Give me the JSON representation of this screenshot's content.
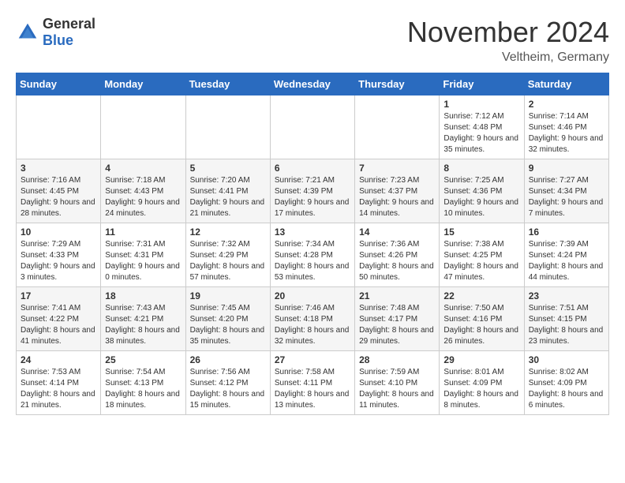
{
  "header": {
    "logo_general": "General",
    "logo_blue": "Blue",
    "month_title": "November 2024",
    "location": "Veltheim, Germany"
  },
  "days_of_week": [
    "Sunday",
    "Monday",
    "Tuesday",
    "Wednesday",
    "Thursday",
    "Friday",
    "Saturday"
  ],
  "weeks": [
    [
      {
        "day": "",
        "info": ""
      },
      {
        "day": "",
        "info": ""
      },
      {
        "day": "",
        "info": ""
      },
      {
        "day": "",
        "info": ""
      },
      {
        "day": "",
        "info": ""
      },
      {
        "day": "1",
        "info": "Sunrise: 7:12 AM\nSunset: 4:48 PM\nDaylight: 9 hours and 35 minutes."
      },
      {
        "day": "2",
        "info": "Sunrise: 7:14 AM\nSunset: 4:46 PM\nDaylight: 9 hours and 32 minutes."
      }
    ],
    [
      {
        "day": "3",
        "info": "Sunrise: 7:16 AM\nSunset: 4:45 PM\nDaylight: 9 hours and 28 minutes."
      },
      {
        "day": "4",
        "info": "Sunrise: 7:18 AM\nSunset: 4:43 PM\nDaylight: 9 hours and 24 minutes."
      },
      {
        "day": "5",
        "info": "Sunrise: 7:20 AM\nSunset: 4:41 PM\nDaylight: 9 hours and 21 minutes."
      },
      {
        "day": "6",
        "info": "Sunrise: 7:21 AM\nSunset: 4:39 PM\nDaylight: 9 hours and 17 minutes."
      },
      {
        "day": "7",
        "info": "Sunrise: 7:23 AM\nSunset: 4:37 PM\nDaylight: 9 hours and 14 minutes."
      },
      {
        "day": "8",
        "info": "Sunrise: 7:25 AM\nSunset: 4:36 PM\nDaylight: 9 hours and 10 minutes."
      },
      {
        "day": "9",
        "info": "Sunrise: 7:27 AM\nSunset: 4:34 PM\nDaylight: 9 hours and 7 minutes."
      }
    ],
    [
      {
        "day": "10",
        "info": "Sunrise: 7:29 AM\nSunset: 4:33 PM\nDaylight: 9 hours and 3 minutes."
      },
      {
        "day": "11",
        "info": "Sunrise: 7:31 AM\nSunset: 4:31 PM\nDaylight: 9 hours and 0 minutes."
      },
      {
        "day": "12",
        "info": "Sunrise: 7:32 AM\nSunset: 4:29 PM\nDaylight: 8 hours and 57 minutes."
      },
      {
        "day": "13",
        "info": "Sunrise: 7:34 AM\nSunset: 4:28 PM\nDaylight: 8 hours and 53 minutes."
      },
      {
        "day": "14",
        "info": "Sunrise: 7:36 AM\nSunset: 4:26 PM\nDaylight: 8 hours and 50 minutes."
      },
      {
        "day": "15",
        "info": "Sunrise: 7:38 AM\nSunset: 4:25 PM\nDaylight: 8 hours and 47 minutes."
      },
      {
        "day": "16",
        "info": "Sunrise: 7:39 AM\nSunset: 4:24 PM\nDaylight: 8 hours and 44 minutes."
      }
    ],
    [
      {
        "day": "17",
        "info": "Sunrise: 7:41 AM\nSunset: 4:22 PM\nDaylight: 8 hours and 41 minutes."
      },
      {
        "day": "18",
        "info": "Sunrise: 7:43 AM\nSunset: 4:21 PM\nDaylight: 8 hours and 38 minutes."
      },
      {
        "day": "19",
        "info": "Sunrise: 7:45 AM\nSunset: 4:20 PM\nDaylight: 8 hours and 35 minutes."
      },
      {
        "day": "20",
        "info": "Sunrise: 7:46 AM\nSunset: 4:18 PM\nDaylight: 8 hours and 32 minutes."
      },
      {
        "day": "21",
        "info": "Sunrise: 7:48 AM\nSunset: 4:17 PM\nDaylight: 8 hours and 29 minutes."
      },
      {
        "day": "22",
        "info": "Sunrise: 7:50 AM\nSunset: 4:16 PM\nDaylight: 8 hours and 26 minutes."
      },
      {
        "day": "23",
        "info": "Sunrise: 7:51 AM\nSunset: 4:15 PM\nDaylight: 8 hours and 23 minutes."
      }
    ],
    [
      {
        "day": "24",
        "info": "Sunrise: 7:53 AM\nSunset: 4:14 PM\nDaylight: 8 hours and 21 minutes."
      },
      {
        "day": "25",
        "info": "Sunrise: 7:54 AM\nSunset: 4:13 PM\nDaylight: 8 hours and 18 minutes."
      },
      {
        "day": "26",
        "info": "Sunrise: 7:56 AM\nSunset: 4:12 PM\nDaylight: 8 hours and 15 minutes."
      },
      {
        "day": "27",
        "info": "Sunrise: 7:58 AM\nSunset: 4:11 PM\nDaylight: 8 hours and 13 minutes."
      },
      {
        "day": "28",
        "info": "Sunrise: 7:59 AM\nSunset: 4:10 PM\nDaylight: 8 hours and 11 minutes."
      },
      {
        "day": "29",
        "info": "Sunrise: 8:01 AM\nSunset: 4:09 PM\nDaylight: 8 hours and 8 minutes."
      },
      {
        "day": "30",
        "info": "Sunrise: 8:02 AM\nSunset: 4:09 PM\nDaylight: 8 hours and 6 minutes."
      }
    ]
  ]
}
